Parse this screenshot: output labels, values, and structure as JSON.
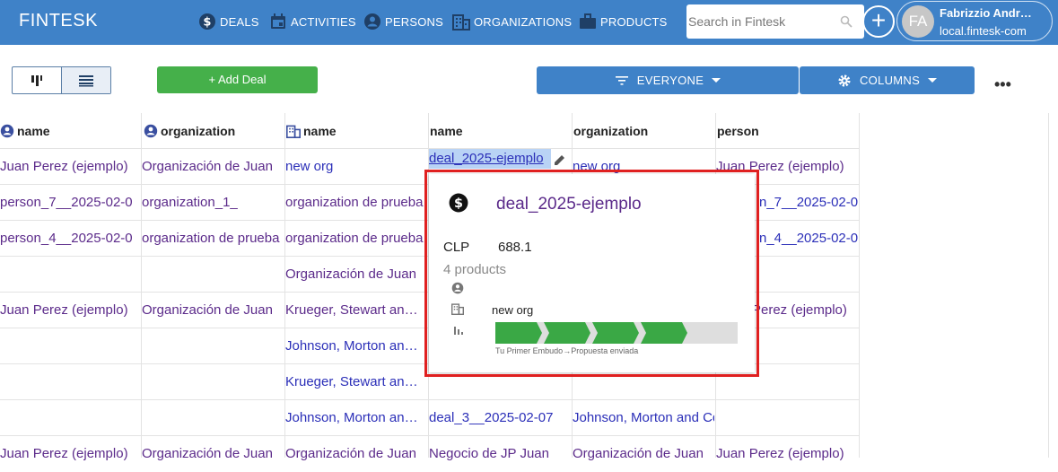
{
  "app": {
    "brand": "FINTESK"
  },
  "nav": [
    {
      "label": "DEALS",
      "icon": "dollar-circle-icon"
    },
    {
      "label": "ACTIVITIES",
      "icon": "calendar-icon"
    },
    {
      "label": "PERSONS",
      "icon": "person-circle-icon"
    },
    {
      "label": "ORGANIZATIONS",
      "icon": "building-icon"
    },
    {
      "label": "PRODUCTS",
      "icon": "briefcase-icon"
    }
  ],
  "search": {
    "placeholder": "Search in Fintesk"
  },
  "user": {
    "initials": "FA",
    "name": "Fabrizzio Andr…",
    "domain": "local.fintesk-com"
  },
  "toolbar": {
    "add_deal_label": "+ Add Deal",
    "filter_label": "EVERYONE",
    "columns_label": "COLUMNS",
    "more_label": "•••"
  },
  "columns": [
    {
      "label": "name",
      "icon": "person-circle-icon"
    },
    {
      "label": "organization",
      "icon": "person-circle-icon"
    },
    {
      "label": "name",
      "icon": "building-icon"
    },
    {
      "label": "name",
      "icon": ""
    },
    {
      "label": "organization",
      "icon": ""
    },
    {
      "label": "person",
      "icon": ""
    }
  ],
  "rows": [
    [
      "Juan Perez (ejemplo)",
      "Organización de Juan",
      "new org",
      "deal_2025-ejemplo",
      "new org",
      "Juan Perez (ejemplo)"
    ],
    [
      "person_7__2025-02-0",
      "organization_1_",
      "organization de prueba",
      "",
      "",
      "n_7__2025-02-0"
    ],
    [
      "person_4__2025-02-0",
      "organization de prueba",
      "organization de prueba",
      "",
      "",
      "n_4__2025-02-0"
    ],
    [
      "",
      "",
      "Organización de Juan",
      "",
      "",
      ""
    ],
    [
      "Juan Perez (ejemplo)",
      "Organización de Juan",
      "Krueger, Stewart and Co",
      "",
      "",
      "Perez (ejemplo)"
    ],
    [
      "",
      "",
      "Johnson, Morton and Co",
      "",
      "",
      ""
    ],
    [
      "",
      "",
      "Krueger, Stewart and Co",
      "",
      "",
      ""
    ],
    [
      "",
      "",
      "Johnson, Morton and Co",
      "deal_3__2025-02-07",
      "Johnson, Morton and Co",
      ""
    ],
    [
      "Juan Perez (ejemplo)",
      "Organización de Juan",
      "Organización de Juan",
      "Negocio de JP Juan",
      "Organización de Juan",
      "Juan Perez (ejemplo)"
    ]
  ],
  "popup": {
    "icon": "dollar-circle-icon",
    "title": "deal_2025-ejemplo",
    "currency": "CLP",
    "amount": "688.1",
    "products": "4 products",
    "organization": "new org",
    "pipeline_caption": "Tu Primer Embudo→Propuesta enviada",
    "stages_total": 5,
    "stages_completed": 4
  }
}
